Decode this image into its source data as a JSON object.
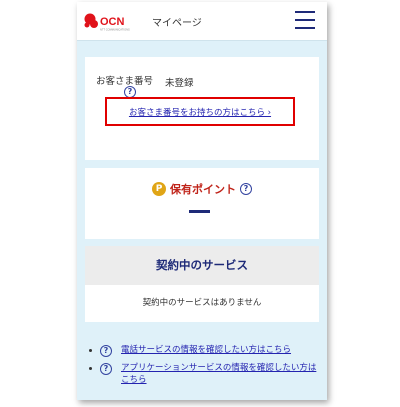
{
  "header": {
    "title": "マイページ",
    "logo_text": "OCN",
    "logo_tagline": "NTT COMMUNICATIONS"
  },
  "customer_card": {
    "label": "お客さま番号",
    "value": "未登録",
    "link": "お客さま番号をお持ちの方はこちら ›",
    "highlight_color": "#e00000"
  },
  "points_card": {
    "coin": "P",
    "title": "保有ポイント"
  },
  "services_card": {
    "title": "契約中のサービス",
    "empty_message": "契約中のサービスはありません"
  },
  "help_links": [
    "電話サービスの情報を確認したい方はこちら",
    "アプリケーションサービスの情報を確認したい方はこちら"
  ],
  "colors": {
    "page_bg": "#dff1f9",
    "accent_navy": "#1e2a78",
    "link": "#2424b0",
    "points_red": "#c0241a",
    "coin": "#e0a516"
  }
}
